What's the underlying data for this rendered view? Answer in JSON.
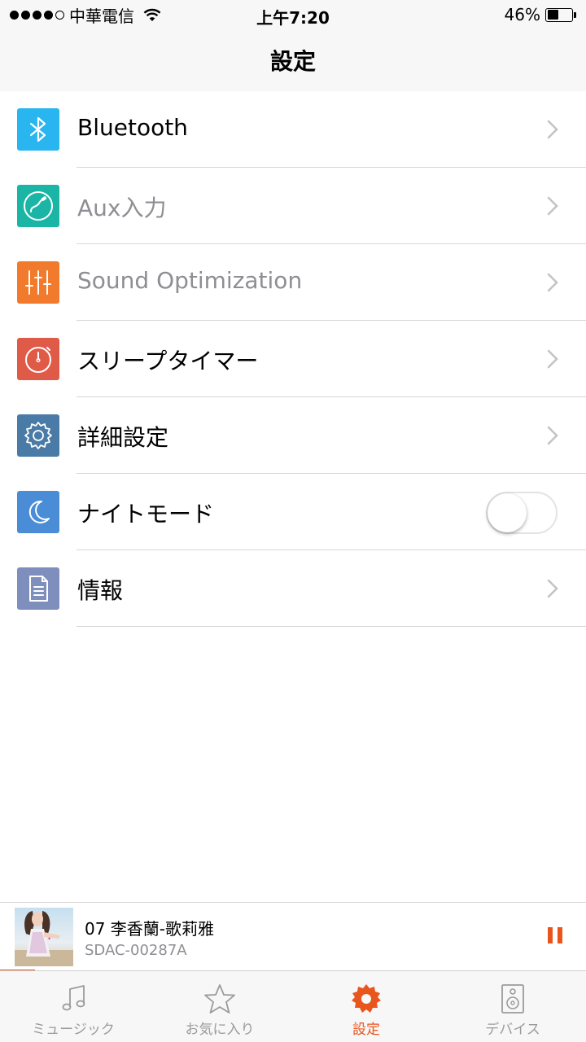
{
  "status_bar": {
    "carrier": "中華電信",
    "time": "上午7:20",
    "battery_percent": "46%",
    "battery_level": 0.46
  },
  "nav": {
    "title": "設定"
  },
  "settings": {
    "items": [
      {
        "label": "Bluetooth",
        "icon": "bluetooth-icon",
        "color": "#29b6f0",
        "enabled": true
      },
      {
        "label": "Aux入力",
        "icon": "aux-input-icon",
        "color": "#1bb5a6",
        "enabled": false
      },
      {
        "label": "Sound Optimization",
        "icon": "equalizer-icon",
        "color": "#f17a2c",
        "enabled": false
      },
      {
        "label": "スリープタイマー",
        "icon": "timer-icon",
        "color": "#e05a48",
        "enabled": true
      },
      {
        "label": "詳細設定",
        "icon": "gear-icon",
        "color": "#4a7ba7",
        "enabled": true
      },
      {
        "label": "ナイトモード",
        "icon": "moon-icon",
        "color": "#4a8cd6",
        "enabled": true,
        "toggle_on": false
      },
      {
        "label": "情報",
        "icon": "document-icon",
        "color": "#7e8fbd",
        "enabled": true
      }
    ]
  },
  "now_playing": {
    "title": "07 李香蘭-歌莉雅",
    "subtitle": "SDAC-00287A",
    "progress": 0.06,
    "accent": "#e8561e"
  },
  "tab_bar": {
    "tabs": [
      {
        "label": "ミュージック",
        "icon": "music-note-icon",
        "active": false
      },
      {
        "label": "お気に入り",
        "icon": "star-icon",
        "active": false
      },
      {
        "label": "設定",
        "icon": "gear-icon",
        "active": true
      },
      {
        "label": "デバイス",
        "icon": "speaker-icon",
        "active": false
      }
    ]
  }
}
